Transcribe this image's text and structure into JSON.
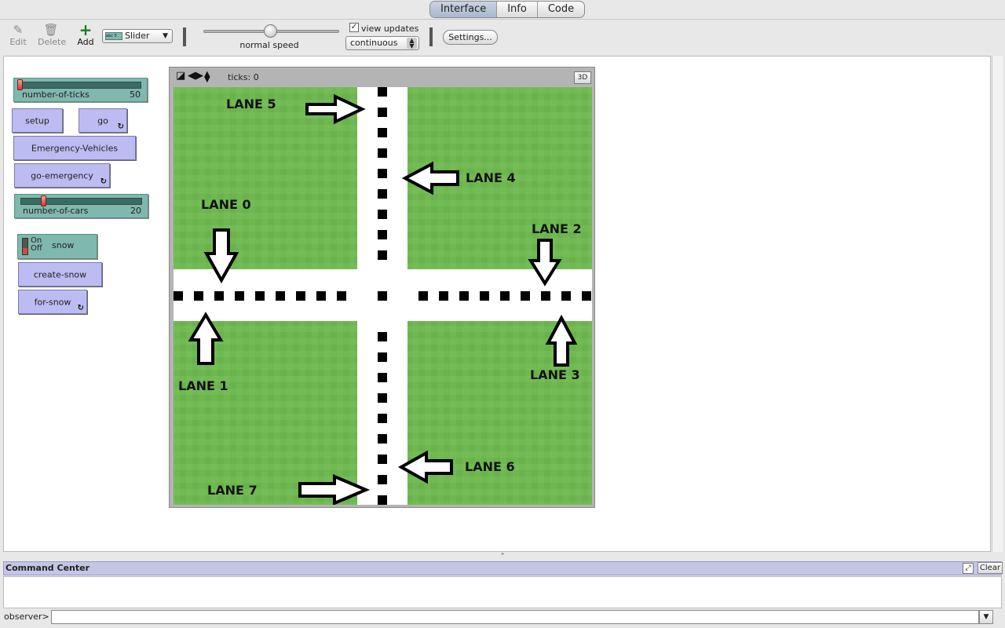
{
  "tabs": [
    {
      "label": "Interface",
      "active": true
    },
    {
      "label": "Info",
      "active": false
    },
    {
      "label": "Code",
      "active": false
    }
  ],
  "toolbar": {
    "edit_label": "Edit",
    "delete_label": "Delete",
    "add_label": "Add",
    "widget_type": "Slider",
    "widget_type_icon_text": "abc 5",
    "speed_label": "normal speed",
    "speed_value": 0.5,
    "view_updates_label": "view updates",
    "view_updates_checked": true,
    "update_mode": "continuous",
    "settings_label": "Settings..."
  },
  "widgets": {
    "number_of_ticks": {
      "name": "number-of-ticks",
      "value": "50",
      "fraction": 0.0
    },
    "setup_label": "setup",
    "go_label": "go",
    "emergency_label": "Emergency-Vehicles",
    "go_emergency_label": "go-emergency",
    "number_of_cars": {
      "name": "number-of-cars",
      "value": "20",
      "fraction": 0.2
    },
    "snow_switch": {
      "name": "snow",
      "on_label": "On",
      "off_label": "Off",
      "state": "off"
    },
    "create_snow_label": "create-snow",
    "for_snow_label": "for-snow",
    "forever_icon": "↻"
  },
  "view": {
    "ticks_text": "ticks: 0",
    "three_d_label": "3D",
    "lanes": {
      "lane0": "LANE 0",
      "lane1": "LANE 1",
      "lane2": "LANE 2",
      "lane3": "LANE 3",
      "lane4": "LANE 4",
      "lane5": "LANE 5",
      "lane6": "LANE 6",
      "lane7": "LANE 7"
    },
    "colors": {
      "grass": "#6fb851",
      "road": "#ffffff",
      "marking": "#000000"
    }
  },
  "command_center": {
    "title": "Command Center",
    "clear_label": "Clear",
    "prompt": "observer>",
    "input_value": ""
  }
}
